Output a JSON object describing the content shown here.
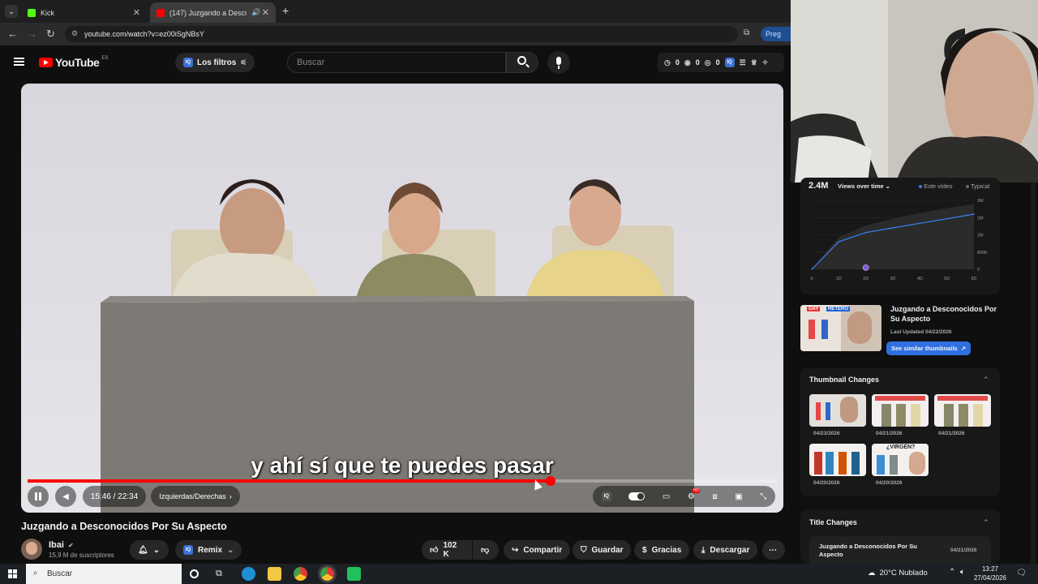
{
  "browser": {
    "tabs": [
      {
        "label": "Kick",
        "active": false
      },
      {
        "label": "(147) Juzgando a Desconoci",
        "active": true
      }
    ],
    "new_tab": "+",
    "url": "youtube.com/watch?v=ez00iSgNBsY",
    "right_button": "Preg"
  },
  "youtube": {
    "logo_text": "YouTube",
    "region": "ES",
    "filter_pill": "Los filtros",
    "search_placeholder": "Buscar",
    "ext_counts": [
      "0",
      "0",
      "0"
    ]
  },
  "player": {
    "subtitle": "y ahí sí que te puedes pasar",
    "time": "15:46 / 22:34",
    "chapter": "Izquierdas/Derechas",
    "progress_fraction": 0.698,
    "hd_badge": "HD"
  },
  "video": {
    "title": "Juzgando a Desconocidos Por Su Aspecto",
    "channel": "Ibai",
    "subscribers": "15,9 M de suscriptores",
    "remix": "Remix",
    "likes": "102 K",
    "share": "Compartir",
    "save": "Guardar",
    "thanks": "Gracias",
    "download": "Descargar"
  },
  "panel": {
    "views": "2.4M",
    "views_mode": "Views over time",
    "legend_this": "Este vídeo",
    "legend_typical": "Typical",
    "chart_y_ticks": [
      "3M",
      "2M",
      "2M",
      "800K",
      "0"
    ],
    "chart_x_ticks": [
      "0",
      "1D",
      "2D",
      "3D",
      "4D",
      "5D",
      "6D"
    ],
    "thumb_title": "Juzgando a Desconocidos Por Su Aspecto",
    "last_updated": "Last Updated 04/22/2026",
    "similar_button": "See similar thumbnails",
    "thumb_overlay_gay": "GAY",
    "thumb_overlay_hetero": "HETERO",
    "thumbnail_changes_title": "Thumbnail Changes",
    "thumbnail_dates": [
      "04/23/2026",
      "04/21/2026",
      "04/21/2026",
      "04/20/2026",
      "04/20/2026"
    ],
    "virgen_text": "¿VIRGEN?",
    "title_changes_title": "Title Changes",
    "title_change_item": "Juzgando a Desconocidos Por Su Aspecto",
    "title_change_date": "04/21/2026"
  },
  "chart_data": {
    "type": "line",
    "x": [
      "0",
      "1D",
      "2D",
      "3D",
      "4D",
      "5D",
      "6D"
    ],
    "series": [
      {
        "name": "Este vídeo",
        "values": [
          0,
          1.2,
          1.6,
          1.8,
          2.0,
          2.2,
          2.4
        ]
      },
      {
        "name": "Typical",
        "values": [
          0,
          1.4,
          1.9,
          2.2,
          2.45,
          2.65,
          2.85
        ]
      }
    ],
    "yticks": [
      "0",
      "800K",
      "2M",
      "2M",
      "3M"
    ],
    "ylim": [
      0,
      3
    ]
  },
  "taskbar": {
    "search": "Buscar",
    "weather": "20°C  Nublado",
    "time": "13:27",
    "date": "27/04/2026"
  },
  "colors": {
    "progress": "#ff0000",
    "accent_blue": "#2f6fe0",
    "chart_line": "#3b82f6"
  }
}
